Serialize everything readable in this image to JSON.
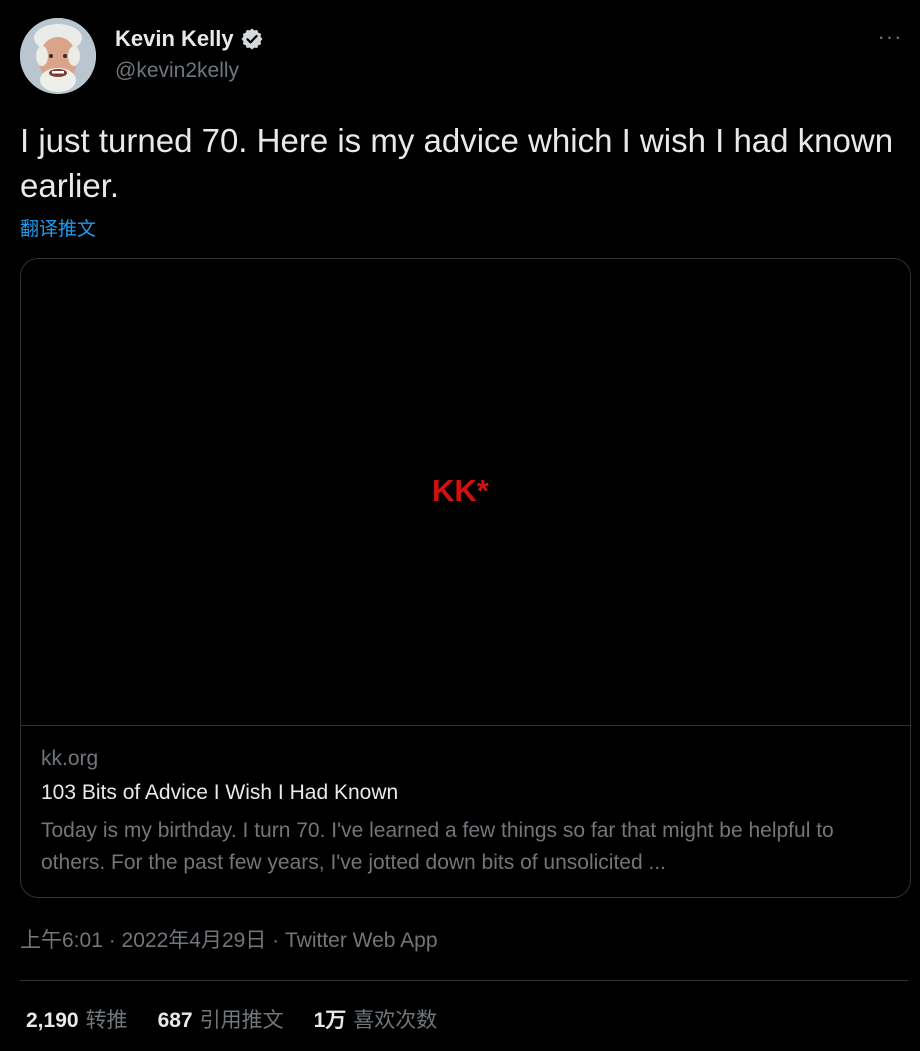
{
  "author": {
    "display_name": "Kevin Kelly",
    "handle": "@kevin2kelly",
    "verified": true
  },
  "more_menu": {
    "icon": "more-horizontal-icon",
    "label": "···"
  },
  "tweet": {
    "text": "I just turned 70. Here is my advice which I wish I had known earlier.",
    "translate_label": "翻译推文"
  },
  "card": {
    "logo_text": "KK*",
    "domain": "kk.org",
    "title": "103 Bits of Advice I Wish I Had Known",
    "description": "Today is my birthday. I turn 70. I've learned a few things so far that might be helpful to others. For the past few years, I've jotted down bits of unsolicited ..."
  },
  "meta": {
    "time": "上午6:01",
    "separator": " · ",
    "date": "2022年4月29日",
    "source": "Twitter Web App"
  },
  "stats": [
    {
      "count": "2,190",
      "label": "转推"
    },
    {
      "count": "687",
      "label": "引用推文"
    },
    {
      "count": "1万",
      "label": "喜欢次数"
    }
  ],
  "colors": {
    "background": "#000000",
    "text": "#e7e9ea",
    "secondary": "#71767b",
    "link": "#1d9bf0",
    "border": "#2f3336",
    "logo_red": "#d01111"
  }
}
